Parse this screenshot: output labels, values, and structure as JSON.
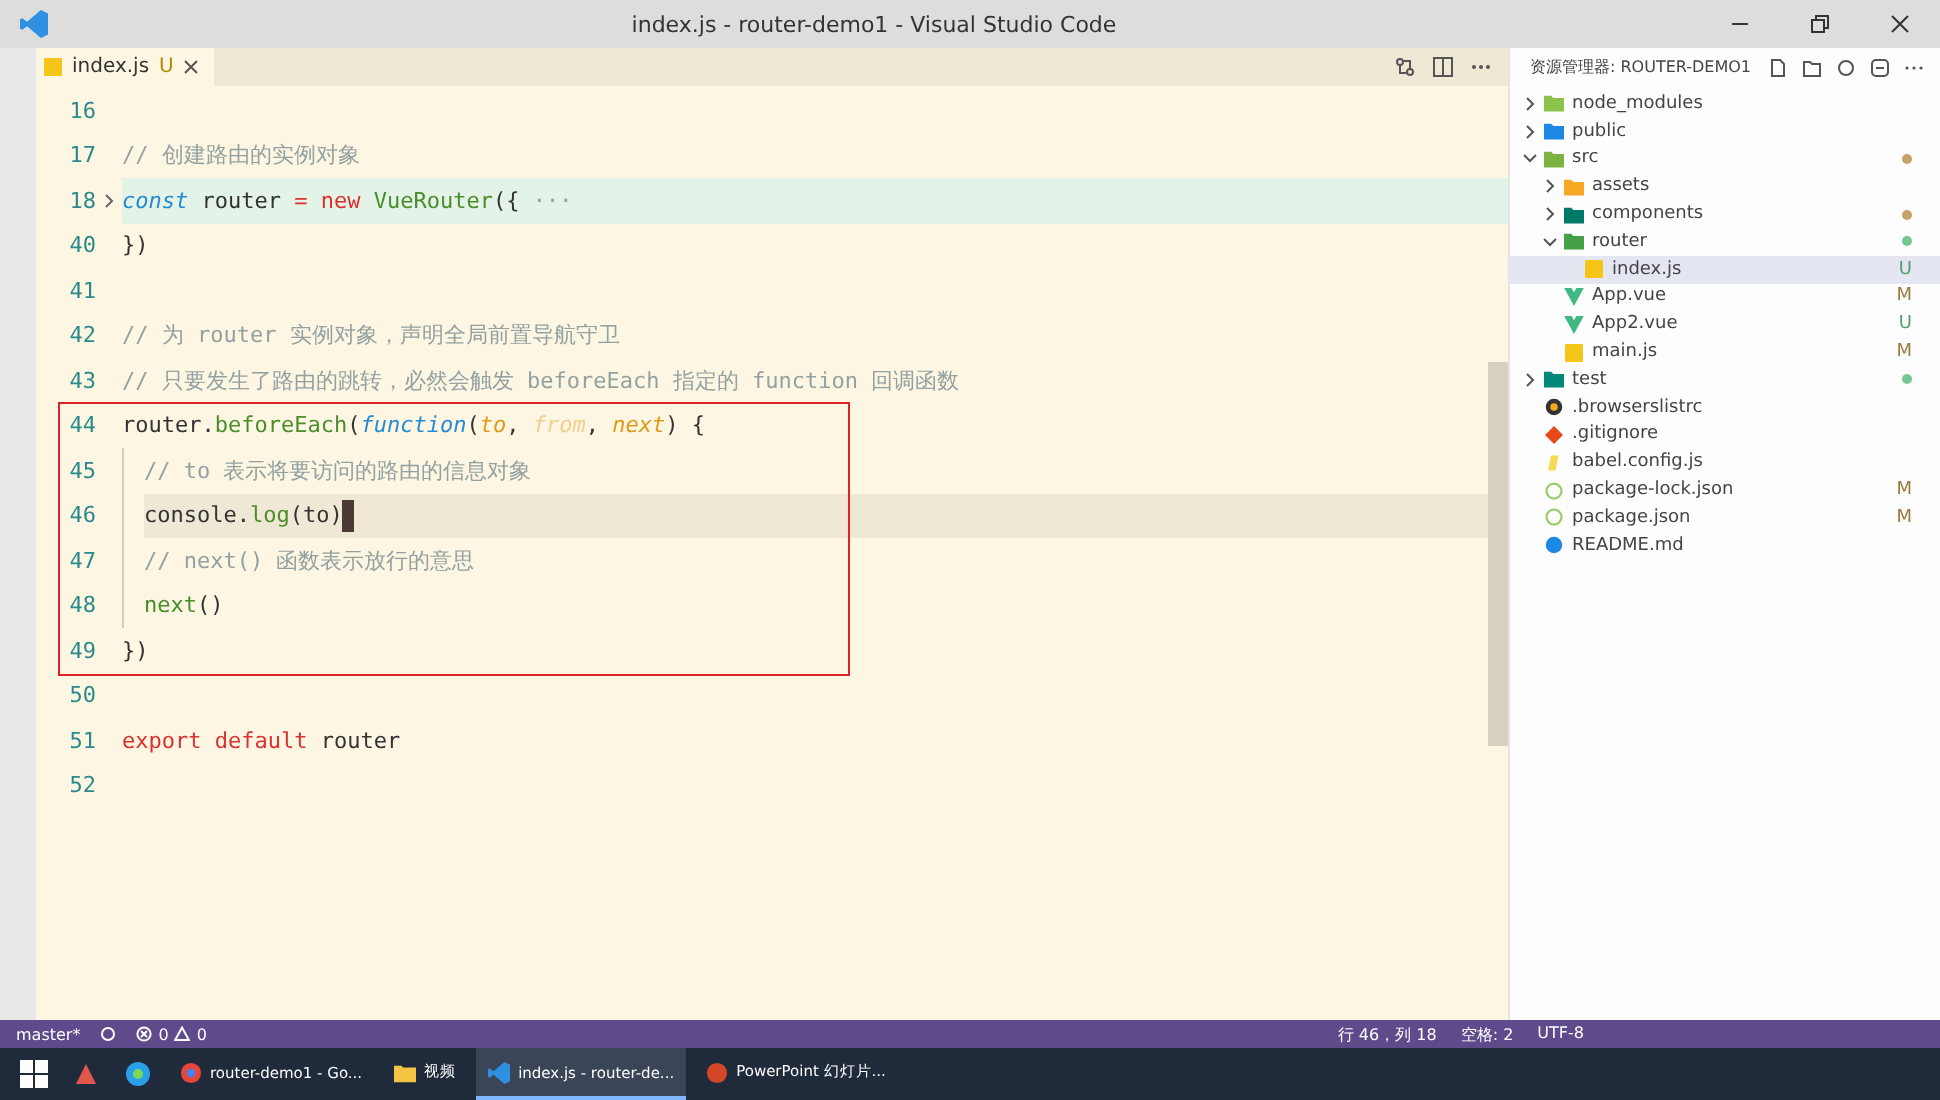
{
  "window": {
    "title": "index.js - router-demo1 - Visual Studio Code"
  },
  "tabs": [
    {
      "label": "index.js",
      "status": "U",
      "selected": true
    }
  ],
  "editor": {
    "lines": [
      {
        "number": "16"
      },
      {
        "number": "17",
        "tokens": [
          {
            "kind": "comment",
            "text": "// 创建路由的实例对象"
          }
        ]
      },
      {
        "number": "18",
        "folded": true,
        "tokens": [
          {
            "kind": "keyword",
            "text": "const"
          },
          {
            "kind": "plain",
            "text": " router "
          },
          {
            "kind": "operator",
            "text": "= new"
          },
          {
            "kind": "function",
            "text": " VueRouter"
          },
          {
            "kind": "plain",
            "text": "({"
          },
          {
            "kind": "comment",
            "text": " ···"
          }
        ]
      },
      {
        "number": "40",
        "tokens": [
          {
            "kind": "plain",
            "text": "})"
          }
        ]
      },
      {
        "number": "41"
      },
      {
        "number": "42",
        "tokens": [
          {
            "kind": "comment",
            "text": "// 为 router 实例对象，声明全局前置导航守卫"
          }
        ]
      },
      {
        "number": "43",
        "tokens": [
          {
            "kind": "comment",
            "text": "// 只要发生了路由的跳转，必然会触发 beforeEach 指定的 function 回调函数"
          }
        ]
      },
      {
        "number": "44",
        "tokens": [
          {
            "kind": "plain",
            "text": "router."
          },
          {
            "kind": "function",
            "text": "beforeEach"
          },
          {
            "kind": "plain",
            "text": "("
          },
          {
            "kind": "keyword",
            "text": "function"
          },
          {
            "kind": "plain",
            "text": "("
          },
          {
            "kind": "param",
            "text": "to"
          },
          {
            "kind": "plain",
            "text": ", "
          },
          {
            "kind": "unused",
            "text": "from"
          },
          {
            "kind": "plain",
            "text": ", "
          },
          {
            "kind": "param",
            "text": "next"
          },
          {
            "kind": "plain",
            "text": ") {"
          }
        ]
      },
      {
        "number": "45",
        "indented": true,
        "tokens": [
          {
            "kind": "comment",
            "text": "// to 表示将要访问的路由的信息对象"
          }
        ]
      },
      {
        "number": "46",
        "indented": true,
        "current": true,
        "tokens": [
          {
            "kind": "plain",
            "text": "console."
          },
          {
            "kind": "function",
            "text": "log"
          },
          {
            "kind": "plain",
            "text": "(to)"
          }
        ]
      },
      {
        "number": "47",
        "indented": true,
        "tokens": [
          {
            "kind": "comment",
            "text": "// next() 函数表示放行的意思"
          }
        ]
      },
      {
        "number": "48",
        "indented": true,
        "tokens": [
          {
            "kind": "function",
            "text": "next"
          },
          {
            "kind": "plain",
            "text": "()"
          }
        ]
      },
      {
        "number": "49",
        "tokens": [
          {
            "kind": "plain",
            "text": "})"
          }
        ]
      },
      {
        "number": "50"
      },
      {
        "number": "51",
        "tokens": [
          {
            "kind": "operator",
            "text": "export default"
          },
          {
            "kind": "plain",
            "text": " router"
          }
        ]
      },
      {
        "number": "52"
      }
    ]
  },
  "explorer": {
    "title": "资源管理器: ROUTER-DEMO1",
    "items": [
      {
        "name": "node_modules",
        "kind": "folder",
        "expanded": false,
        "selected": false
      },
      {
        "name": "public",
        "kind": "folder",
        "expanded": false,
        "selected": false
      },
      {
        "name": "src",
        "kind": "folder",
        "expanded": true,
        "selected": false,
        "color": "#c9a26b",
        "children": [
          {
            "name": "assets",
            "kind": "folder",
            "expanded": false,
            "selected": false
          },
          {
            "name": "components",
            "kind": "folder",
            "expanded": false,
            "selected": false,
            "color": "#c9a26b"
          },
          {
            "name": "router",
            "kind": "folder",
            "expanded": true,
            "selected": false,
            "color": "#73c991",
            "children": [
              {
                "name": "index.js",
                "kind": "js",
                "selected": true,
                "status": "U"
              }
            ]
          },
          {
            "name": "App.vue",
            "kind": "vue",
            "selected": false,
            "status": "M"
          },
          {
            "name": "App2.vue",
            "kind": "vue",
            "selected": false,
            "status": "U"
          },
          {
            "name": "main.js",
            "kind": "js",
            "selected": false,
            "status": "M"
          }
        ]
      },
      {
        "name": "test",
        "kind": "folder",
        "expanded": false,
        "selected": false,
        "color": "#73c991"
      },
      {
        "name": ".browserslistrc",
        "kind": "config",
        "selected": false
      },
      {
        "name": ".gitignore",
        "kind": "git",
        "selected": false
      },
      {
        "name": "babel.config.js",
        "kind": "babel",
        "selected": false
      },
      {
        "name": "package-lock.json",
        "kind": "json",
        "selected": false,
        "status": "M"
      },
      {
        "name": "package.json",
        "kind": "json",
        "selected": false,
        "status": "M"
      },
      {
        "name": "README.md",
        "kind": "readme",
        "selected": false
      }
    ]
  },
  "status_bar": {
    "branch": "master*",
    "errors": "0",
    "warnings": "0",
    "right": [
      "行 46，列 18",
      "空格: 2",
      "UTF-8"
    ]
  },
  "taskbar": {
    "windows": [
      {
        "label": "router-demo1 - Go...",
        "kind": "browser",
        "selected": false
      },
      {
        "label": "视频",
        "kind": "folder",
        "selected": false
      },
      {
        "label": "index.js - router-de...",
        "kind": "editor",
        "selected": true
      },
      {
        "label": "PowerPoint 幻灯片...",
        "kind": "slides",
        "selected": false
      }
    ]
  }
}
